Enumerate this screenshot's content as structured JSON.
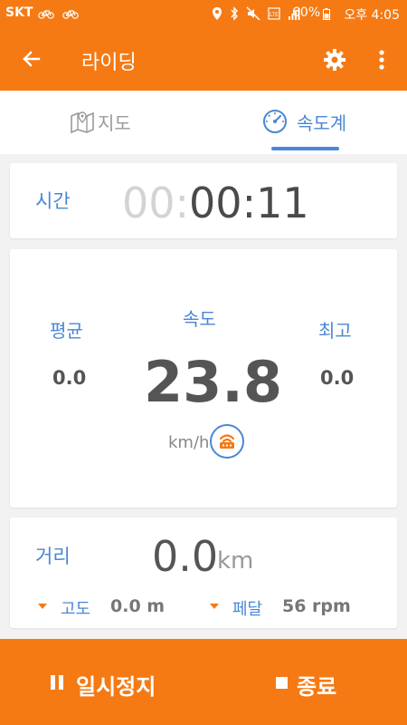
{
  "status_bar": {
    "carrier": "SKT",
    "battery_percent": "60%",
    "clock": "오후 4:05",
    "icons": [
      "bicycle-icon",
      "bicycle-icon",
      "location-icon",
      "bluetooth-icon",
      "mute-icon",
      "lte-icon",
      "signal-icon",
      "battery-icon"
    ]
  },
  "app_bar": {
    "title": "라이딩",
    "icons": [
      "back-arrow-icon",
      "gear-icon",
      "more-vert-icon"
    ]
  },
  "tabs": [
    {
      "label": "지도",
      "icon": "map-icon",
      "selected": false
    },
    {
      "label": "속도계",
      "icon": "speedometer-icon",
      "selected": true
    }
  ],
  "time": {
    "label": "시간",
    "hours": "00:",
    "rest": "00:11"
  },
  "speed": {
    "avg_label": "평균",
    "avg_value": "0.0",
    "speed_label": "속도",
    "speed_value": "23.8",
    "unit": "km/h",
    "max_label": "최고",
    "max_value": "0.0",
    "sensor_icon": "sensor-icon"
  },
  "distance": {
    "label": "거리",
    "value": "0.0",
    "unit": "km",
    "altitude_label": "고도",
    "altitude_value": "0.0 m",
    "pedal_label": "페달",
    "pedal_value": "56 rpm"
  },
  "bottom_bar": {
    "pause_label": "일시정지",
    "stop_label": "종료"
  },
  "colors": {
    "accent": "#f57a14",
    "blue": "#4b86d6"
  }
}
